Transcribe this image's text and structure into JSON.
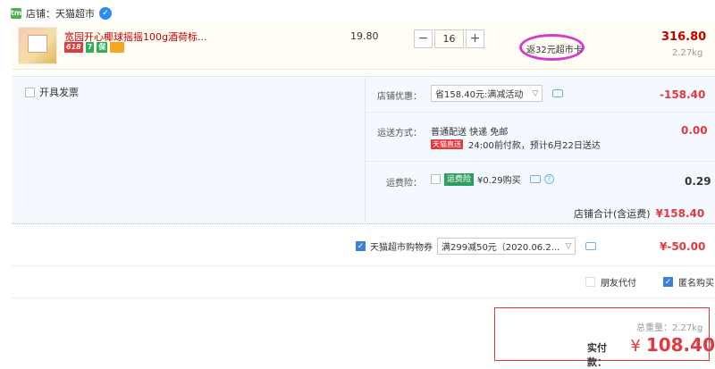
{
  "shop": {
    "label": "店铺：",
    "name": "天猫超市",
    "icon_text": "tm",
    "badge_text": "✓"
  },
  "product": {
    "title": "宽园开心椰球摇摇100g酒荷标...",
    "tags": [
      "618",
      "7",
      "保",
      "卡"
    ],
    "unit_price": "19.80",
    "quantity": "16",
    "qty_minus": "−",
    "qty_plus": "+",
    "rebate": "返32元超市卡",
    "subtotal": "316.80",
    "weight": "2.27kg"
  },
  "invoice": {
    "label": "开具发票"
  },
  "shop_discount": {
    "label": "店铺优惠：",
    "value": "省158.40元:满减活动",
    "amount": "-158.40"
  },
  "shipping": {
    "label": "运送方式：",
    "method": "普通配送 快递 免邮",
    "tag": "天猫直送",
    "note": "24:00前付款，预计6月22日送达",
    "amount": "0.00"
  },
  "insurance": {
    "label": "运费险：",
    "tag": "运费险",
    "price": "¥0.29购买",
    "help": "?",
    "amount": "0.29"
  },
  "shop_total": {
    "label": "店铺合计(含运费)",
    "amount": "¥158.40"
  },
  "coupon": {
    "label": "天猫超市购物券",
    "value": "满299减50元（2020.06.2...",
    "amount": "¥-50.00"
  },
  "options": {
    "friend_pay": "朋友代付",
    "anonymous": "匿名购买"
  },
  "summary": {
    "total_weight_label": "总重量：",
    "total_weight": "2.27kg",
    "pay_label": "实付款：",
    "currency": "¥",
    "pay_amount": "108.40"
  },
  "colors": {
    "accent": "#e4393c",
    "price_red": "#c40000",
    "oval": "#d43ccf",
    "info_bg": "#f3f9ff"
  }
}
